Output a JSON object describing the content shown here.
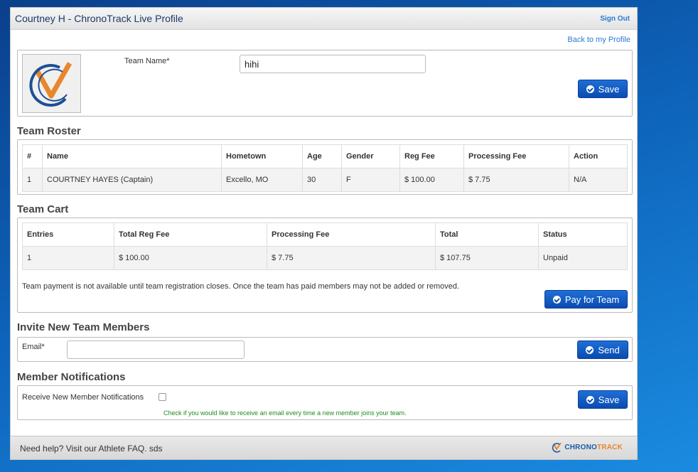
{
  "header": {
    "title": "Courtney H - ChronoTrack Live Profile",
    "sign_out": "Sign Out"
  },
  "back_link": "Back to my Profile",
  "team": {
    "name_label": "Team Name*",
    "name_value": "hihi",
    "save_label": "Save"
  },
  "roster": {
    "title": "Team Roster",
    "columns": [
      "#",
      "Name",
      "Hometown",
      "Age",
      "Gender",
      "Reg Fee",
      "Processing Fee",
      "Action"
    ],
    "rows": [
      [
        "1",
        "COURTNEY HAYES (Captain)",
        "Excello, MO",
        "30",
        "F",
        "$ 100.00",
        "$ 7.75",
        "N/A"
      ]
    ]
  },
  "cart": {
    "title": "Team Cart",
    "columns": [
      "Entries",
      "Total Reg Fee",
      "Processing Fee",
      "Total",
      "Status"
    ],
    "rows": [
      [
        "1",
        "$ 100.00",
        "$ 7.75",
        "$ 107.75",
        "Unpaid"
      ]
    ],
    "note": "Team payment is not available until team registration closes. Once the team has paid members may not be added or removed.",
    "pay_label": "Pay for Team"
  },
  "invite": {
    "title": "Invite New Team Members",
    "email_label": "Email*",
    "email_value": "",
    "send_label": "Send"
  },
  "notifications": {
    "title": "Member Notifications",
    "checkbox_label": "Receive New Member Notifications",
    "help_text": "Check if you would like to receive an email every time a new member joins your team.",
    "save_label": "Save"
  },
  "footer": {
    "help": "Need help? Visit our Athlete FAQ. sds",
    "brand_main": "CHRONO",
    "brand_accent": "TRACK"
  },
  "colors": {
    "accent": "#1e6fd6",
    "link": "#2a7ad4",
    "note_green": "#1f8a1f"
  }
}
